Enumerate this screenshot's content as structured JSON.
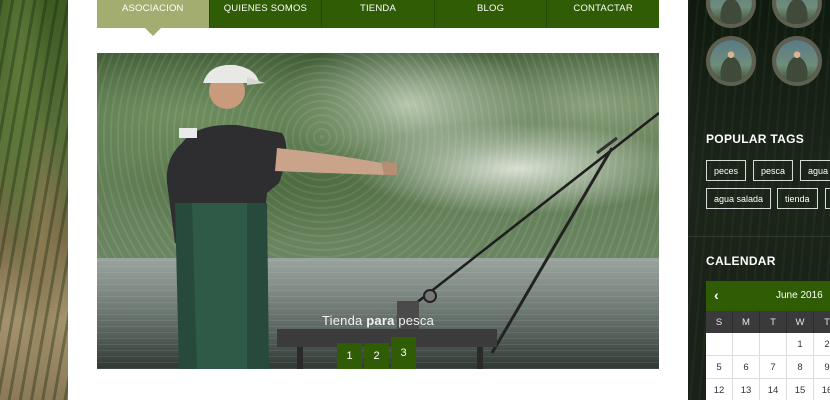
{
  "nav": {
    "items": [
      {
        "label": "ASOCIACION",
        "active": true
      },
      {
        "label": "QUIENES SOMOS"
      },
      {
        "label": "TIENDA"
      },
      {
        "label": "BLOG"
      },
      {
        "label": "CONTACTAR"
      }
    ]
  },
  "slider": {
    "caption_pre": "Tienda ",
    "caption_bold": "para",
    "caption_post": " pesca",
    "pages": [
      "1",
      "2",
      "3"
    ],
    "active_page": "3"
  },
  "sidebar": {
    "popular_tags": {
      "heading": "POPULAR TAGS",
      "tags": [
        "peces",
        "pesca",
        "agua",
        "agua salada",
        "tienda"
      ]
    },
    "calendar": {
      "heading": "CALENDAR",
      "prev_label": "‹",
      "month": "June 2016",
      "weekdays": [
        "S",
        "M",
        "T",
        "W",
        "T"
      ],
      "rows": [
        [
          "",
          "",
          "",
          "1",
          "2"
        ],
        [
          "5",
          "6",
          "7",
          "8",
          "9"
        ],
        [
          "12",
          "13",
          "14",
          "15",
          "16"
        ]
      ]
    }
  },
  "colors": {
    "nav_green": "#2f5c05",
    "nav_active": "#a3ad70"
  }
}
